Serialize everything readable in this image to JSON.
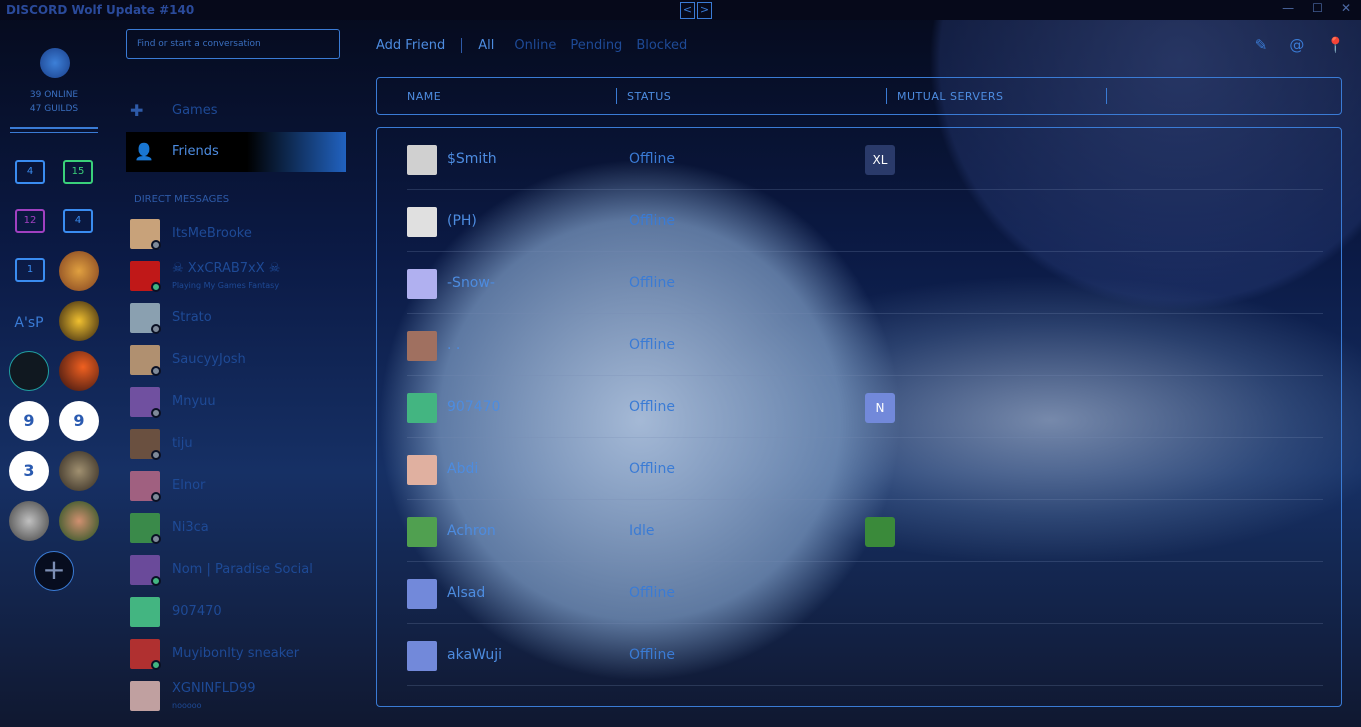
{
  "titlebar": {
    "title": "DISCORD Wolf Update #140",
    "back": "<",
    "forward": ">",
    "minimize": "—",
    "maximize": "☐",
    "close": "✕"
  },
  "sidebar": {
    "online_count": "39 ONLINE",
    "guild_count": "47 GUILDS",
    "folders": [
      {
        "count": "4",
        "color": "#3a8cf0"
      },
      {
        "count": "15",
        "color": "#3ad07a"
      },
      {
        "count": "12",
        "color": "#a040c0"
      },
      {
        "count": "4",
        "color": "#3a8cf0"
      },
      {
        "count": "1",
        "color": "#3a8cf0"
      }
    ],
    "text_server": "A'sP",
    "add_server": "+"
  },
  "channels": {
    "search_placeholder": "Find or start a conversation",
    "games_label": "Games",
    "friends_label": "Friends",
    "dm_header": "DIRECT MESSAGES",
    "dms": [
      {
        "name": "ItsMeBrooke",
        "sub": "",
        "status": "#7f8a99",
        "color": "#c8a27a"
      },
      {
        "name": "☠ XxCRAB7xX ☠",
        "sub": "Playing My Games Fantasy",
        "status": "#43b581",
        "color": "#c01818"
      },
      {
        "name": "Strato",
        "sub": "",
        "status": "#7f8a99",
        "color": "#8aa0b0"
      },
      {
        "name": "SaucyyJosh",
        "sub": "",
        "status": "#7f8a99",
        "color": "#b09070"
      },
      {
        "name": "Mnyuu",
        "sub": "",
        "status": "#7f8a99",
        "color": "#7050a0"
      },
      {
        "name": "tiju",
        "sub": "",
        "status": "#7f8a99",
        "color": "#6a5040"
      },
      {
        "name": "Elnor",
        "sub": "",
        "status": "#7f8a99",
        "color": "#a06080"
      },
      {
        "name": "Ni3ca",
        "sub": "",
        "status": "#7f8a99",
        "color": "#3a8a4a"
      },
      {
        "name": "Nom | Paradise Social",
        "sub": "",
        "status": "#43b581",
        "color": "#6a4a9a"
      },
      {
        "name": "907470",
        "sub": "",
        "status": "",
        "color": "#43b581"
      },
      {
        "name": "Muyibonlty sneaker",
        "sub": "",
        "status": "#43b581",
        "color": "#b03030"
      },
      {
        "name": "XGNINFLD99",
        "sub": "nooooo",
        "status": "",
        "color": "#c0a0a0"
      }
    ]
  },
  "topbar": {
    "add_friend": "Add Friend",
    "tabs": [
      "All",
      "Online",
      "Pending",
      "Blocked"
    ]
  },
  "friends_table": {
    "headers": {
      "name": "NAME",
      "status": "STATUS",
      "mutual": "MUTUAL SERVERS"
    },
    "rows": [
      {
        "name": "$Smith",
        "status": "Offline",
        "mutual": "XL",
        "avatar_color": "#d0d0d0",
        "mutual_color": "#2a3a6a"
      },
      {
        "name": "(PH)",
        "status": "Offline",
        "mutual": "",
        "avatar_color": "#e0e0e0",
        "mutual_color": ""
      },
      {
        "name": "-Snow-",
        "status": "Offline",
        "mutual": "",
        "avatar_color": "#b0b0f0",
        "mutual_color": ""
      },
      {
        "name": ". .",
        "status": "Offline",
        "mutual": "",
        "avatar_color": "#a07060",
        "mutual_color": ""
      },
      {
        "name": "907470",
        "status": "Offline",
        "mutual": "N",
        "avatar_color": "#43b581",
        "mutual_color": "#7289da"
      },
      {
        "name": "Abdi",
        "status": "Offline",
        "mutual": "",
        "avatar_color": "#e0b0a0",
        "mutual_color": ""
      },
      {
        "name": "Achron",
        "status": "Idle",
        "mutual": "",
        "avatar_color": "#50a050",
        "mutual_color": "#3a8a3a"
      },
      {
        "name": "Alsad",
        "status": "Offline",
        "mutual": "",
        "avatar_color": "#7289da",
        "mutual_color": ""
      },
      {
        "name": "akaWuji",
        "status": "Offline",
        "mutual": "",
        "avatar_color": "#7289da",
        "mutual_color": ""
      }
    ]
  }
}
